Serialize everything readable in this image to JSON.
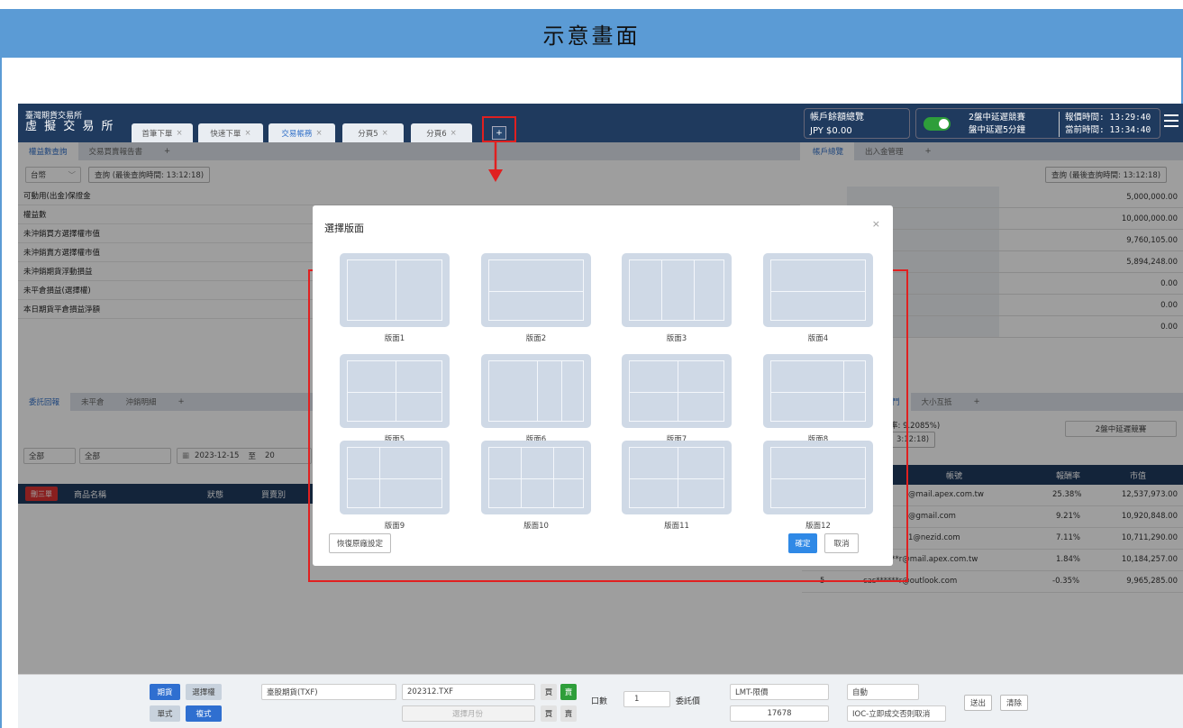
{
  "banner_title": "示意畫面",
  "app": {
    "logo_line1": "臺灣期貨交易所",
    "logo_line2": "虛 擬 交 易 所",
    "page_tabs": [
      {
        "label": "首筆下單",
        "close": "×"
      },
      {
        "label": "快速下單",
        "close": "×"
      },
      {
        "label": "交易帳務",
        "close": "×"
      },
      {
        "label": "分頁5",
        "close": "×"
      },
      {
        "label": "分頁6",
        "close": "×"
      }
    ],
    "add_page": "+",
    "account": {
      "title": "帳戶餘額總覽",
      "value": "JPY $0.00"
    },
    "status": {
      "delay1": "2盤中延遲競賽",
      "delay2": "盤中延遲5分鐘",
      "quote_time_label": "報價時間:",
      "quote_time": "13:29:40",
      "now_label": "當前時間:",
      "now_time": "13:34:40"
    }
  },
  "left_top": {
    "tabs": [
      "權益數查詢",
      "交易買賣報告書",
      "+"
    ],
    "market_select": "台幣",
    "query_button": "查詢 (最後查詢時間: 13:12:18)",
    "rows": [
      "可動用(出金)保證金",
      "權益數",
      "未沖銷買方選擇權市值",
      "未沖銷賣方選擇權市值",
      "未沖銷期貨浮動損益",
      "未平倉損益(選擇權)",
      "本日期貨平倉損益淨額"
    ]
  },
  "left_bottom": {
    "tabs": [
      "委託回報",
      "未平倉",
      "沖銷明細",
      "+"
    ],
    "filter1": "全部",
    "filter2": "全部",
    "date_from": "2023-12-15",
    "date_to_label": "至",
    "date_to_fragment": "20",
    "delete_button": "刪三單",
    "columns": [
      "商品名稱",
      "狀態",
      "買賣別"
    ]
  },
  "right_top": {
    "tabs": [
      "帳戶總覽",
      "出入金管理",
      "+"
    ],
    "query_button": "查詢 (最後查詢時間: 13:12:18)",
    "values": [
      "5,000,000.00",
      "10,000,000.00",
      "9,760,105.00",
      "5,894,248.00",
      "0.00",
      "0.00",
      "0.00"
    ]
  },
  "right_bottom": {
    "tab_fragment": "鬥",
    "tabs": [
      "大小互抵",
      "+"
    ],
    "rate_text": "率: 9.2085%)",
    "time_text": "3:12:18)",
    "contest_select": "2盤中延遲競賽",
    "columns": [
      "帳號",
      "報酬率",
      "市值"
    ],
    "rows": [
      {
        "rank": "",
        "account": "@mail.apex.com.tw",
        "rate": "25.38%",
        "value": "12,537,973.00"
      },
      {
        "rank": "",
        "account": "@gmail.com",
        "rate": "9.21%",
        "value": "10,920,848.00"
      },
      {
        "rank": "",
        "account": "1@nezid.com",
        "rate": "7.11%",
        "value": "10,711,290.00"
      },
      {
        "rank": "4",
        "account": "cas******r@mail.apex.com.tw",
        "rate": "1.84%",
        "value": "10,184,257.00"
      },
      {
        "rank": "5",
        "account": "cas******r@outlook.com",
        "rate": "-0.35%",
        "value": "9,965,285.00"
      }
    ]
  },
  "bottom_bar": {
    "futures": "期貨",
    "options": "選擇權",
    "single": "單式",
    "combo": "複式",
    "product": "臺股期貨(TXF)",
    "contract": "202312.TXF",
    "month_placeholder": "選擇月份",
    "buy": "買",
    "sell": "賣",
    "qty_label": "口數",
    "qty": "1",
    "price_label": "委託價",
    "order_type": "LMT-限價",
    "price": "17678",
    "auto": "自動",
    "ioc": "IOC-立即成交否則取消",
    "submit": "送出",
    "clear": "清除"
  },
  "modal": {
    "title": "選擇版面",
    "close": "×",
    "layouts": [
      "版面1",
      "版面2",
      "版面3",
      "版面4",
      "版面5",
      "版面6",
      "版面7",
      "版面8",
      "版面9",
      "版面10",
      "版面11",
      "版面12"
    ],
    "reset": "恢復原廠設定",
    "confirm": "確定",
    "cancel": "取消"
  },
  "colors": {
    "accent": "#2f89e6",
    "header": "#1f3a5e",
    "highlight": "#e02020",
    "banner": "#5b9bd5"
  }
}
